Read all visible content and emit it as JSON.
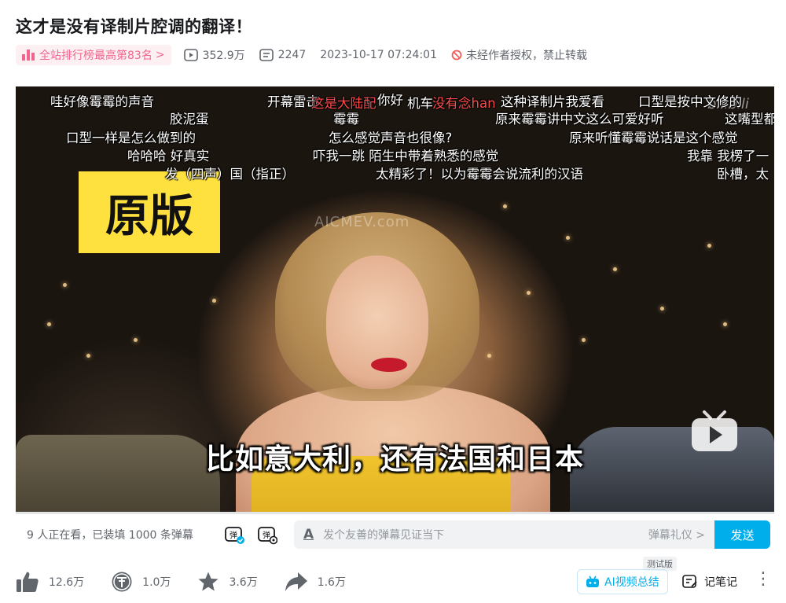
{
  "video_title": "这才是没有译制片腔调的翻译！",
  "meta": {
    "rank_label": "全站排行榜最高第83名",
    "rank_chevron": ">",
    "views": "352.9万",
    "danmaku_count": "2247",
    "publish_time": "2023-10-17 07:24:01",
    "copyright_notice": "未经作者授权，禁止转载"
  },
  "player": {
    "badge_text": "原版",
    "subtitle": "比如意大利，还有法国和日本",
    "watermark": "AICMEV.com",
    "corner_logo": "bilibili",
    "progress_percent": 0,
    "danmaku": [
      {
        "text": "哇好像霉霉的声音"
      },
      {
        "text": "开幕雷击"
      },
      {
        "text": "这是大陆配"
      },
      {
        "text": "你好"
      },
      {
        "text": "机车"
      },
      {
        "text": "没有念han"
      },
      {
        "text": "这种译制片我爱看"
      },
      {
        "text": "口型是按中文修的"
      },
      {
        "text": "胶泥蛋"
      },
      {
        "text": "霉霉"
      },
      {
        "text": "原来霉霉讲中文这么可爱好听"
      },
      {
        "text": "这嘴型都"
      },
      {
        "text": "口型一样是怎么做到的"
      },
      {
        "text": "怎么感觉声音也很像?"
      },
      {
        "text": "原来听懂霉霉说话是这个感觉"
      },
      {
        "text": "哈哈哈 好真实"
      },
      {
        "text": "吓我一跳 陌生中带着熟悉的感觉"
      },
      {
        "text": "我靠 我楞了一"
      },
      {
        "text": "发（四声）国（指正）"
      },
      {
        "text": "太精彩了！以为霉霉会说流利的汉语"
      },
      {
        "text": "卧槽，太"
      }
    ]
  },
  "send_bar": {
    "viewer_info": "9 人正在看，已装填 1000 条弹幕",
    "dm_toggle_label": "弹",
    "dm_settings_label": "弹",
    "input_placeholder": "发个友善的弹幕见证当下",
    "etiquette_label": "弹幕礼仪 >",
    "send_label": "发送",
    "font_icon_label": "A"
  },
  "actions": {
    "like_count": "12.6万",
    "coin_count": "1.0万",
    "favorite_count": "3.6万",
    "share_count": "1.6万",
    "ai_summary_label": "AI视频总结",
    "beta_tag": "测试版",
    "notes_label": "记笔记",
    "more_label": "⋮"
  },
  "colors": {
    "accent_blue": "#00aeec",
    "rank_pink": "#f2658f",
    "badge_yellow": "#fee13f",
    "danmaku_red": "#ff4a4a"
  }
}
